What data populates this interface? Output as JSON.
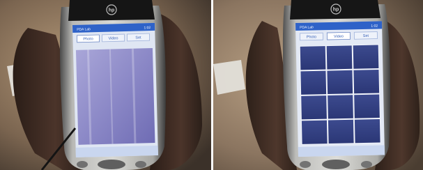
{
  "figure": {
    "panels": [
      {
        "id": "left",
        "device": {
          "logo": "hp",
          "title_bar": {
            "app_title": "PDA Lab",
            "time": "1:02"
          },
          "tabs": [
            "Photo",
            "Video",
            "Set"
          ],
          "selected_tab": "Photo",
          "screen_state": "blank camera preview"
        }
      },
      {
        "id": "right",
        "device": {
          "logo": "hp",
          "title_bar": {
            "app_title": "PDA Lab",
            "time": "1:02"
          },
          "tabs": [
            "Photo",
            "Video",
            "Set"
          ],
          "selected_tab": "Video",
          "screen_state": "3 x 4 grid of tiles",
          "grid": {
            "columns": 3,
            "rows": 4
          }
        }
      }
    ]
  }
}
